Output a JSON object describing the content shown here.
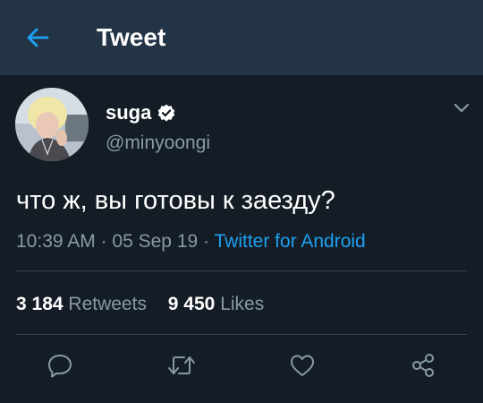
{
  "colors": {
    "header_bg": "#243447",
    "body_bg": "#141d26",
    "accent": "#1da1f2",
    "muted": "#8899a6"
  },
  "header": {
    "back_icon": "arrow-left-icon",
    "title": "Tweet"
  },
  "tweet": {
    "author": {
      "display_name": "suga",
      "verified": true,
      "handle": "@minyoongi"
    },
    "text": "что ж, вы готовы к заезду?",
    "time": "10:39 AM",
    "date": "05 Sep 19",
    "separator": "·",
    "source": "Twitter for Android",
    "stats": {
      "retweets_count": "3 184",
      "retweets_label": "Retweets",
      "likes_count": "9 450",
      "likes_label": "Likes"
    },
    "actions": [
      "reply-icon",
      "retweet-icon",
      "like-icon",
      "share-icon"
    ]
  }
}
